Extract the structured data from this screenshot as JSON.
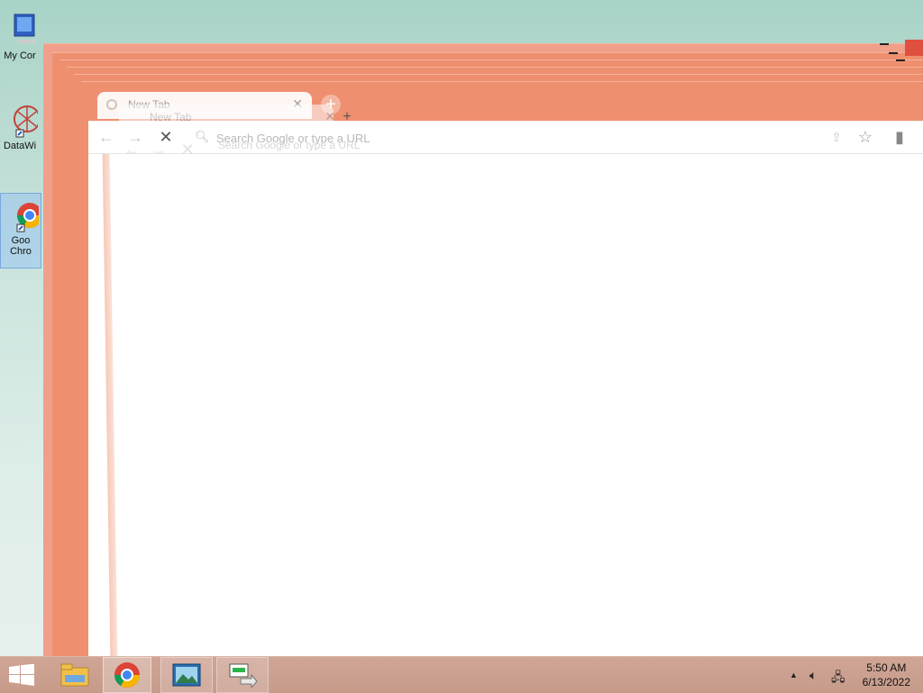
{
  "desktop": {
    "icons": [
      {
        "label": "My Cor"
      },
      {
        "label": "DataWi"
      },
      {
        "label": "Goo\nChro"
      }
    ]
  },
  "browser": {
    "tabs": [
      {
        "title": "New Tab"
      },
      {
        "title": "New Tab"
      }
    ],
    "omnibox": {
      "placeholder": "Search Google or type a URL",
      "ghost_text": "Search Google or type a URL"
    }
  },
  "taskbar": {
    "clock": {
      "time": "5:50 AM",
      "date": "6/13/2022"
    }
  },
  "colors": {
    "accent": "#ee8f6f",
    "taskbar": "#c99e8d"
  },
  "icons": {
    "start": "windows-logo-icon",
    "explorer": "folder-icon",
    "chrome": "chrome-icon",
    "photos": "photos-icon",
    "migrate": "migration-icon",
    "tray_up": "chevron-up-icon",
    "volume": "speaker-muted-icon",
    "network": "network-icon"
  }
}
